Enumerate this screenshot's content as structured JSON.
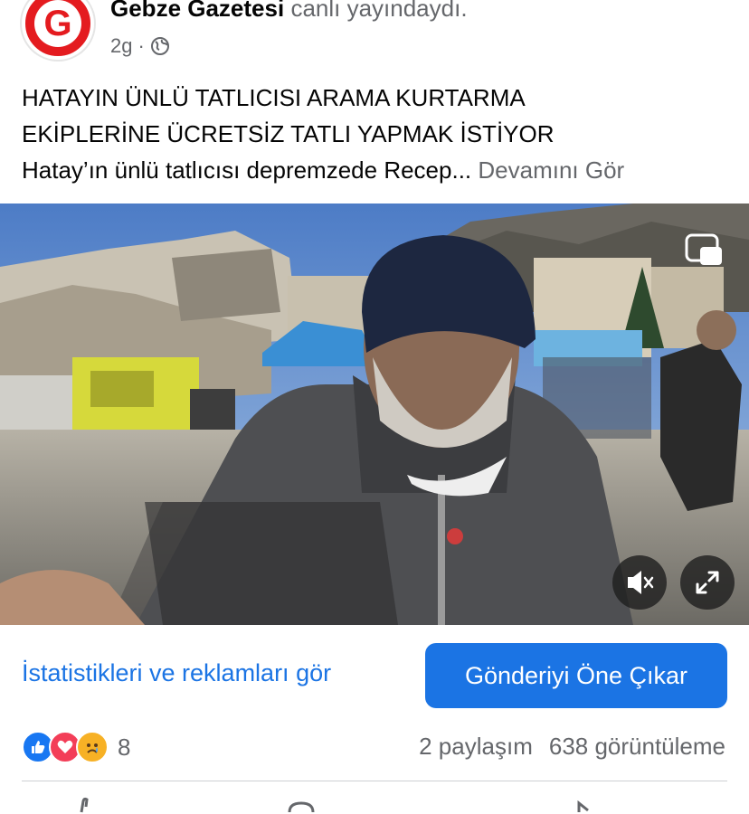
{
  "post": {
    "page_name": "Gebze Gazetesi",
    "action_text": "canlı yayındaydı.",
    "time": "2g",
    "separator": "·",
    "audience_icon": "globe-icon",
    "logo_letter": "G",
    "text_line1": "HATAYIN ÜNLÜ TATLICISI  ARAMA  KURTARMA",
    "text_line2": "EKİPLERİNE ÜCRETSİZ  TATLI YAPMAK İSTİYOR",
    "text_line3": "Hatay’ın ünlü tatlıcısı depremzede Recep...",
    "see_more": "Devamını Gör"
  },
  "video": {
    "pip_icon": "picture-in-picture-icon",
    "mute_icon": "speaker-muted-icon",
    "fullscreen_icon": "expand-icon"
  },
  "actions": {
    "stats_link": "İstatistikleri ve reklamları gör",
    "boost_button": "Gönderiyi Öne Çıkar"
  },
  "engagement": {
    "reactions": [
      "like-icon",
      "love-icon",
      "sad-icon"
    ],
    "reaction_count": "8",
    "shares": "2 paylaşım",
    "views": "638 görüntüleme"
  },
  "colors": {
    "brand_red": "#e41b1f",
    "link_blue": "#1b74e4",
    "muted_text": "#65676b"
  }
}
